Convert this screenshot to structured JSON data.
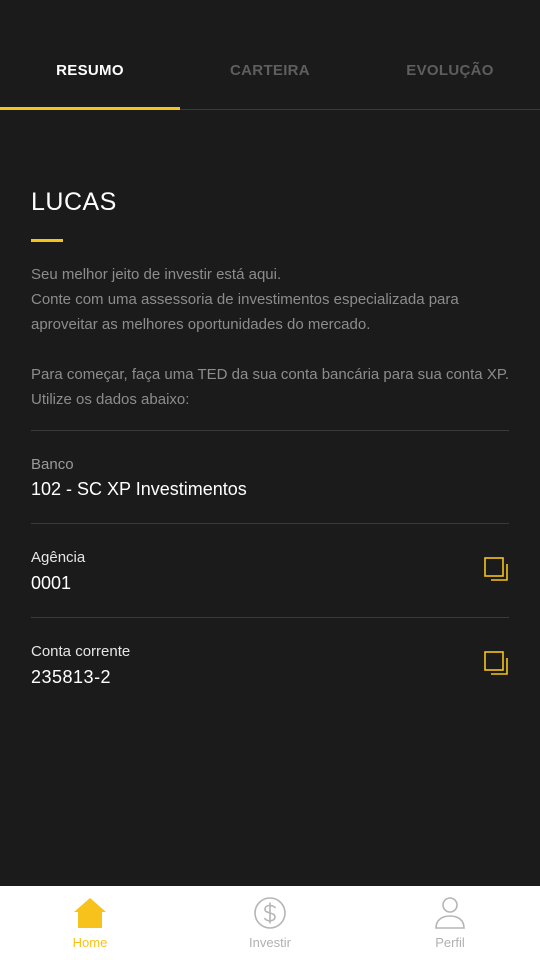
{
  "tabs": [
    {
      "label": "RESUMO",
      "active": true
    },
    {
      "label": "CARTEIRA",
      "active": false
    },
    {
      "label": "EVOLUÇÃO",
      "active": false
    }
  ],
  "profile": {
    "name": "LUCAS"
  },
  "intro": {
    "line1": "Seu melhor jeito de investir está aqui.",
    "line2": "Conte com uma assessoria de investimentos especializada para aproveitar as melhores oportunidades do mercado.",
    "line3": "Para começar, faça uma TED da sua conta bancária para sua conta XP. Utilize os dados abaixo:"
  },
  "bank": {
    "label": "Banco",
    "value": "102 - SC XP Investimentos"
  },
  "agency": {
    "label": "Agência",
    "value": "0001",
    "copy_icon": "copy-icon"
  },
  "account": {
    "label": "Conta corrente",
    "value": "235813-2",
    "copy_icon": "copy-icon"
  },
  "bottom_nav": [
    {
      "label": "Home",
      "icon": "home-icon",
      "active": true
    },
    {
      "label": "Investir",
      "icon": "dollar-circle-icon",
      "active": false
    },
    {
      "label": "Perfil",
      "icon": "person-icon",
      "active": false
    }
  ],
  "colors": {
    "accent": "#f7c21c",
    "background": "#1b1b1b",
    "muted_text": "#8c8c8c",
    "nav_inactive": "#b0b0b0"
  }
}
